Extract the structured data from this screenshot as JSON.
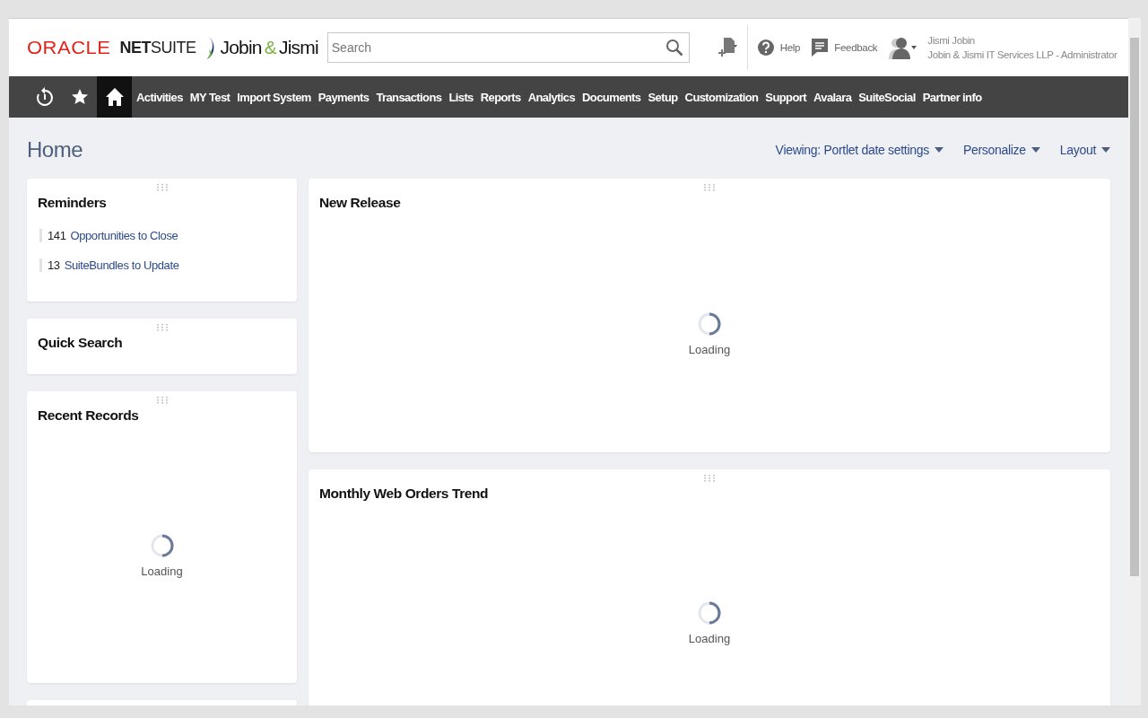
{
  "header": {
    "brand": {
      "oracle": "ORACLE",
      "netsuite_bold": "NET",
      "netsuite_light": "SUITE",
      "partner_first": "Jobin",
      "partner_amp": "&",
      "partner_last": "Jismi"
    },
    "search": {
      "placeholder": "Search"
    },
    "actions": [
      {
        "kind": "help",
        "label": "Help"
      },
      {
        "kind": "feedback",
        "label": "Feedback"
      }
    ],
    "user": {
      "name": "Jismi Jobin",
      "account": "Jobin & Jismi IT Services LLP - Administrator"
    }
  },
  "nav": {
    "icon_tabs": [
      {
        "selected": false
      },
      {
        "selected": false
      },
      {
        "selected": true
      }
    ],
    "items": [
      "Activities",
      "MY Test",
      "Import System",
      "Payments",
      "Transactions",
      "Lists",
      "Reports",
      "Analytics",
      "Documents",
      "Setup",
      "Customization",
      "Support",
      "Avalara",
      "SuiteSocial",
      "Partner info"
    ]
  },
  "page": {
    "title": "Home",
    "actions": [
      "Viewing: Portlet date settings",
      "Personalize",
      "Layout"
    ]
  },
  "left_portlets": [
    {
      "kind": "reminders",
      "title": "Reminders",
      "reminders": [
        {
          "count": "141",
          "label": "Opportunities to Close"
        },
        {
          "count": "13",
          "label": "SuiteBundles to Update"
        }
      ]
    },
    {
      "kind": "plain",
      "title": "Quick Search"
    },
    {
      "kind": "loading",
      "title": "Recent Records",
      "status": "Loading"
    },
    {
      "kind": "plain"
    }
  ],
  "right_portlets": [
    {
      "kind": "loading",
      "title": "New Release",
      "status": "Loading"
    },
    {
      "kind": "loading",
      "title": "Monthly Web Orders Trend",
      "status": "Loading"
    }
  ]
}
